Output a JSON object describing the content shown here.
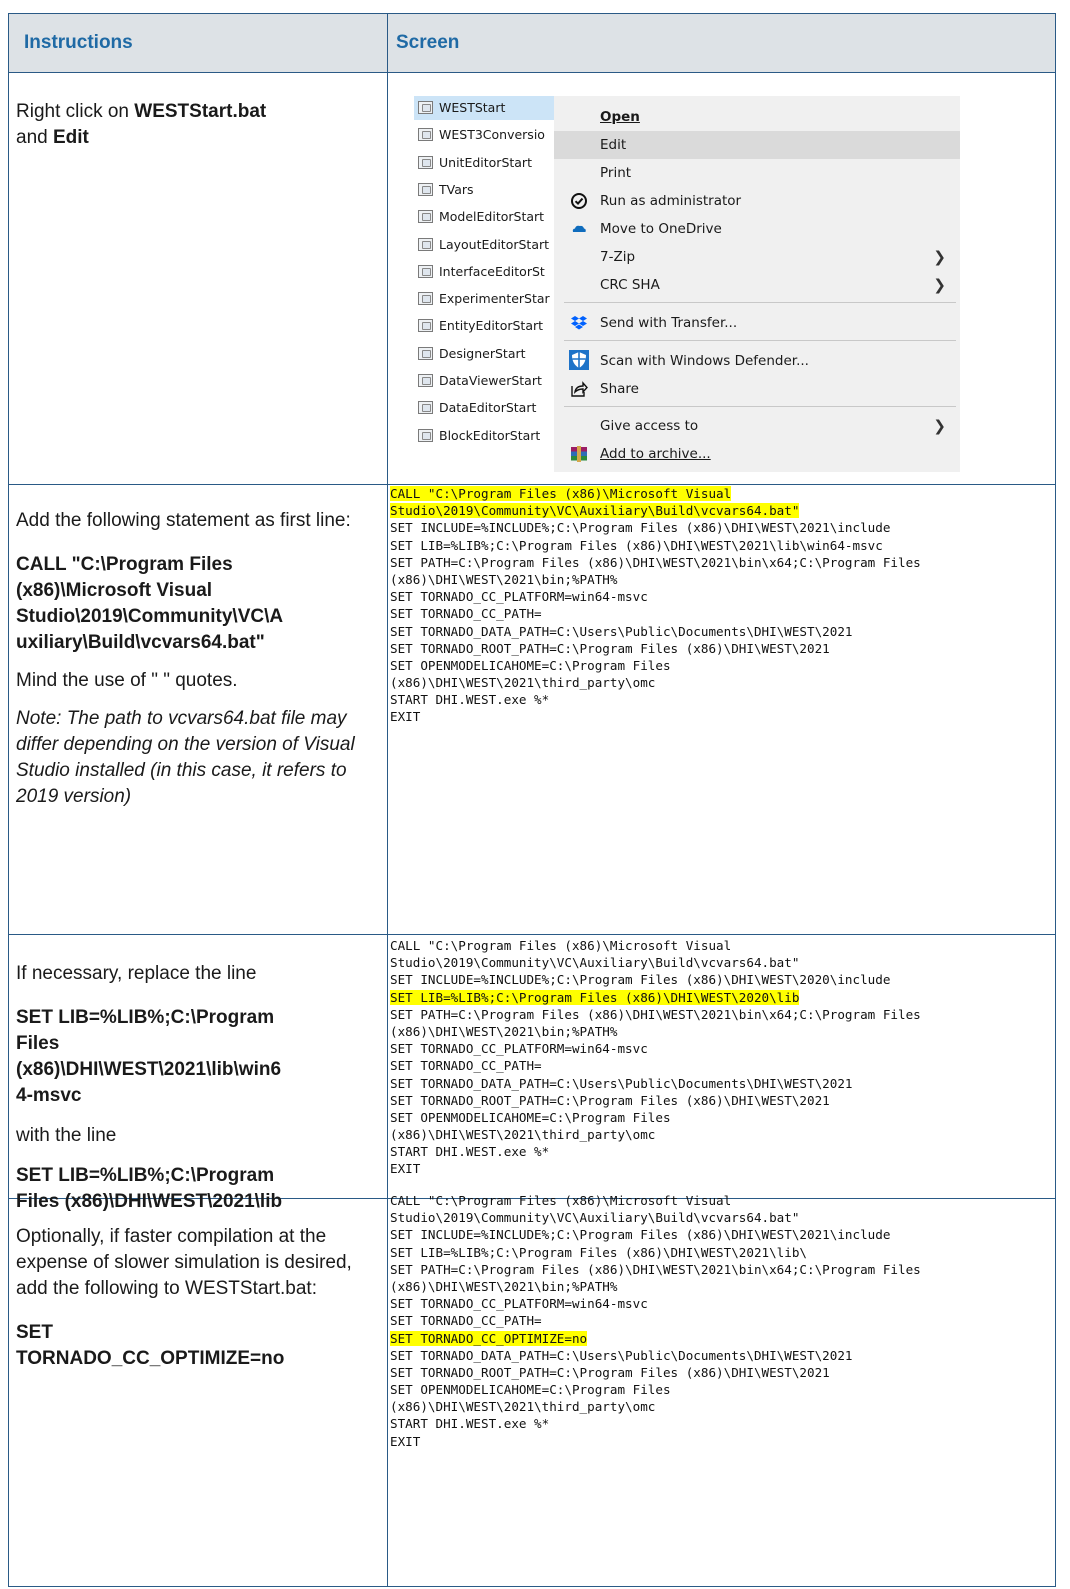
{
  "header": {
    "col1": "Instructions",
    "col2": "Screen"
  },
  "row1": {
    "text_a": "Right click on ",
    "bold_a": "WESTStart.bat",
    "text_b": "and ",
    "bold_b": "Edit",
    "files": [
      "WESTStart",
      "WEST3Conversio",
      "UnitEditorStart",
      "TVars",
      "ModelEditorStart",
      "LayoutEditorStart",
      "InterfaceEditorSt",
      "ExperimenterStar",
      "EntityEditorStart",
      "DesignerStart",
      "DataViewerStart",
      "DataEditorStart",
      "BlockEditorStart"
    ],
    "menu": {
      "open": "Open",
      "edit": "Edit",
      "print": "Print",
      "run_admin": "Run as administrator",
      "onedrive": "Move to OneDrive",
      "zip": "7-Zip",
      "crc": "CRC SHA",
      "transfer": "Send with Transfer...",
      "defender": "Scan with Windows Defender...",
      "share": "Share",
      "give_access": "Give access to",
      "archive": "Add to archive..."
    }
  },
  "row2": {
    "p1": "Add the following statement as first line:",
    "p2_l1": "CALL \"C:\\Program Files",
    "p2_l2": "(x86)\\Microsoft Visual",
    "p2_l3": "Studio\\2019\\Community\\VC\\A",
    "p2_l4": "uxiliary\\Build\\vcvars64.bat\"",
    "p3": "Mind the use of \" \" quotes.",
    "note": "Note: The path to vcvars64.bat file may differ depending on the version of Visual Studio installed (in this case, it refers to 2019 version)",
    "code": [
      "CALL \"C:\\Program Files (x86)\\Microsoft Visual",
      "Studio\\2019\\Community\\VC\\Auxiliary\\Build\\vcvars64.bat\"",
      "SET INCLUDE=%INCLUDE%;C:\\Program Files (x86)\\DHI\\WEST\\2021\\include",
      "SET LIB=%LIB%;C:\\Program Files (x86)\\DHI\\WEST\\2021\\lib\\win64-msvc",
      "SET PATH=C:\\Program Files (x86)\\DHI\\WEST\\2021\\bin\\x64;C:\\Program Files",
      "(x86)\\DHI\\WEST\\2021\\bin;%PATH%",
      "SET TORNADO_CC_PLATFORM=win64-msvc",
      "SET TORNADO_CC_PATH=",
      "SET TORNADO_DATA_PATH=C:\\Users\\Public\\Documents\\DHI\\WEST\\2021",
      "SET TORNADO_ROOT_PATH=C:\\Program Files (x86)\\DHI\\WEST\\2021",
      "SET OPENMODELICAHOME=C:\\Program Files",
      "(x86)\\DHI\\WEST\\2021\\third_party\\omc",
      "START DHI.WEST.exe %*",
      "EXIT"
    ]
  },
  "row3": {
    "p1": "If necessary, replace the line",
    "b1_l1": "SET LIB=%LIB%;C:\\Program",
    "b1_l2": "Files",
    "b1_l3": "(x86)\\DHI\\WEST\\2021\\lib\\win6",
    "b1_l4": "4-msvc",
    "p2": "with the line",
    "b2_l1": "SET LIB=%LIB%;C:\\Program",
    "b2_l2": "Files (x86)\\DHI\\WEST\\2021\\lib",
    "code": [
      "CALL \"C:\\Program Files (x86)\\Microsoft Visual",
      "Studio\\2019\\Community\\VC\\Auxiliary\\Build\\vcvars64.bat\"",
      "SET INCLUDE=%INCLUDE%;C:\\Program Files (x86)\\DHI\\WEST\\2020\\include",
      "SET LIB=%LIB%;C:\\Program Files (x86)\\DHI\\WEST\\2020\\lib",
      "SET PATH=C:\\Program Files (x86)\\DHI\\WEST\\2021\\bin\\x64;C:\\Program Files",
      "(x86)\\DHI\\WEST\\2021\\bin;%PATH%",
      "SET TORNADO_CC_PLATFORM=win64-msvc",
      "SET TORNADO_CC_PATH=",
      "SET TORNADO_DATA_PATH=C:\\Users\\Public\\Documents\\DHI\\WEST\\2021",
      "SET TORNADO_ROOT_PATH=C:\\Program Files (x86)\\DHI\\WEST\\2021",
      "SET OPENMODELICAHOME=C:\\Program Files",
      "(x86)\\DHI\\WEST\\2021\\third_party\\omc",
      "START DHI.WEST.exe %*",
      "EXIT"
    ]
  },
  "row4": {
    "p1": "Optionally, if faster compilation at the expense of slower simulation is desired, add the following to WESTStart.bat:",
    "b1_l1": "SET",
    "b1_l2": "TORNADO_CC_OPTIMIZE=no",
    "code": [
      "CALL \"C:\\Program Files (x86)\\Microsoft Visual",
      "Studio\\2019\\Community\\VC\\Auxiliary\\Build\\vcvars64.bat\"",
      "SET INCLUDE=%INCLUDE%;C:\\Program Files (x86)\\DHI\\WEST\\2021\\include",
      "SET LIB=%LIB%;C:\\Program Files (x86)\\DHI\\WEST\\2021\\lib\\",
      "SET PATH=C:\\Program Files (x86)\\DHI\\WEST\\2021\\bin\\x64;C:\\Program Files",
      "(x86)\\DHI\\WEST\\2021\\bin;%PATH%",
      "SET TORNADO_CC_PLATFORM=win64-msvc",
      "SET TORNADO_CC_PATH=",
      "SET TORNADO_CC_OPTIMIZE=no",
      "SET TORNADO_DATA_PATH=C:\\Users\\Public\\Documents\\DHI\\WEST\\2021",
      "SET TORNADO_ROOT_PATH=C:\\Program Files (x86)\\DHI\\WEST\\2021",
      "SET OPENMODELICAHOME=C:\\Program Files",
      "(x86)\\DHI\\WEST\\2021\\third_party\\omc",
      "START DHI.WEST.exe %*",
      "EXIT"
    ]
  }
}
